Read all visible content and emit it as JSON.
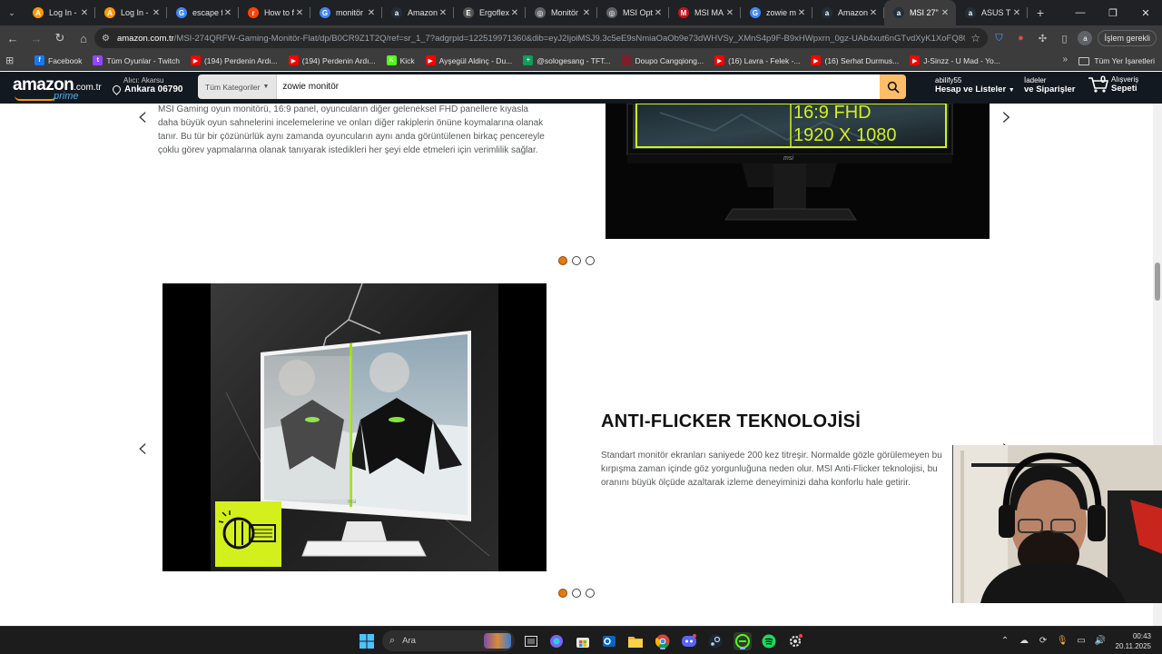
{
  "browser": {
    "tabs": [
      {
        "title": "Log In -",
        "icon": "aws-icon",
        "color": "#ff9900",
        "glyph": "A",
        "active": false
      },
      {
        "title": "Log In - ",
        "icon": "aws-icon",
        "color": "#ff9900",
        "glyph": "A",
        "active": false
      },
      {
        "title": "escape f",
        "icon": "google-icon",
        "color": "#4285f4",
        "glyph": "G",
        "active": false
      },
      {
        "title": "How to f",
        "icon": "reddit-icon",
        "color": "#ff4500",
        "glyph": "r",
        "active": false
      },
      {
        "title": "monitör",
        "icon": "google-icon",
        "color": "#4285f4",
        "glyph": "G",
        "active": false
      },
      {
        "title": "Amazon.",
        "icon": "amazon-icon",
        "color": "#232f3e",
        "glyph": "a",
        "active": false
      },
      {
        "title": "Ergoflex",
        "icon": "ergoflex-icon",
        "color": "#555555",
        "glyph": "E",
        "active": false
      },
      {
        "title": "Monitör",
        "icon": "globe-icon",
        "color": "#5f6368",
        "glyph": "◎",
        "active": false
      },
      {
        "title": "MSI Opt",
        "icon": "globe-icon",
        "color": "#5f6368",
        "glyph": "◎",
        "active": false
      },
      {
        "title": "MSI MA",
        "icon": "msi-icon",
        "color": "#c5161d",
        "glyph": "M",
        "active": false
      },
      {
        "title": "zowie m",
        "icon": "google-icon",
        "color": "#4285f4",
        "glyph": "G",
        "active": false
      },
      {
        "title": "Amazon",
        "icon": "amazon-icon",
        "color": "#232f3e",
        "glyph": "a",
        "active": false
      },
      {
        "title": "MSI 27\"",
        "icon": "amazon-icon",
        "color": "#232f3e",
        "glyph": "a",
        "active": true
      },
      {
        "title": "ASUS TU",
        "icon": "amazon-icon",
        "color": "#232f3e",
        "glyph": "a",
        "active": false
      }
    ],
    "url_domain": "amazon.com.tr",
    "url_path": "/MSI-274QRFW-Gaming-Monitör-Flat/dp/B0CR9Z1T2Q/ref=sr_1_7?adgrpid=122519971360&dib=eyJ2IjoiMSJ9.3c5eE9sNmiaOaOb9e73dWHVSy_XMnS4p9F-B9xHWpxrn_0gz-UAb4xut6nGTvdXyK1XoFQ80GP9-R...",
    "done_label": "İşlem gerekli",
    "profile_initial": "a"
  },
  "bookmarks": [
    {
      "label": "Facebook",
      "icon": "facebook-icon",
      "color": "#1877f2",
      "glyph": "f"
    },
    {
      "label": "Tüm Oyunlar - Twitch",
      "icon": "twitch-icon",
      "color": "#9146ff",
      "glyph": "t"
    },
    {
      "label": "(194) Perdenin Ardı...",
      "icon": "youtube-icon",
      "color": "#ff0000",
      "glyph": "▶"
    },
    {
      "label": "(194) Perdenin Ardı...",
      "icon": "youtube-icon",
      "color": "#ff0000",
      "glyph": "▶"
    },
    {
      "label": "Kick",
      "icon": "kick-icon",
      "color": "#53fc18",
      "glyph": "K"
    },
    {
      "label": "Ayşegül Aldinç - Du...",
      "icon": "youtube-icon",
      "color": "#ff0000",
      "glyph": "▶"
    },
    {
      "label": "@sologesang - TFT...",
      "icon": "sheets-icon",
      "color": "#0f9d58",
      "glyph": "+"
    },
    {
      "label": "Doupo Cangqiong...",
      "icon": "site-icon",
      "color": "#7a1f2b",
      "glyph": ""
    },
    {
      "label": "(16) Lavra - Felek -...",
      "icon": "youtube-icon",
      "color": "#ff0000",
      "glyph": "▶"
    },
    {
      "label": "(16) Serhat Durmus...",
      "icon": "youtube-icon",
      "color": "#ff0000",
      "glyph": "▶"
    },
    {
      "label": "J-Sinzz - U Mad - Yo...",
      "icon": "youtube-icon",
      "color": "#ff0000",
      "glyph": "▶"
    }
  ],
  "bookmarks_all": "Tüm Yer İşaretleri",
  "amazon": {
    "logo_word": "amazon",
    "logo_tld": ".com.tr",
    "logo_prime": "prime",
    "deliver_line1": "Alıcı: Akarsu",
    "deliver_line2": "Ankara 06790",
    "search_category": "Tüm Kategoriler",
    "search_value": "zowie monitör",
    "account_line1": "abilify55",
    "account_line2": "Hesap ve Listeler",
    "orders_line1": "İadeler",
    "orders_line2": "ve Siparişler",
    "cart_count": "0",
    "cart_line1": "Alışveriş",
    "cart_line2": "Sepeti"
  },
  "section1": {
    "text": "MSI Gaming oyun monitörü, 16:9 panel, oyuncuların diğer geleneksel FHD panellere kıyasla daha büyük oyun sahnelerini incelemelerine ve onları diğer rakiplerin önüne koymalarına olanak tanır. Bu tür bir çözünürlük aynı zamanda oyuncuların aynı anda görüntülenen birkaç pencereyle çoklu görev yapmalarına olanak tanıyarak istedikleri her şeyi elde etmeleri için verimlilik sağlar.",
    "banner_line1": "16:9 FHD",
    "banner_line2": "1920 X 1080",
    "banner_brand": "msi",
    "dots_active": 0
  },
  "section2": {
    "title": "ANTI-FLICKER TEKNOLOJİSİ",
    "text": "Standart monitör ekranları saniyede 200 kez titreşir. Normalde gözle görülemeyen bu kırpışma zaman içinde göz yorgunluğuna neden olur. MSI Anti-Flicker teknolojisi, bu oranını büyük ölçüde azaltarak izleme deneyiminizi daha konforlu hale getirir.",
    "dots_active": 0
  },
  "taskbar": {
    "search_label": "Ara",
    "time": "00:43",
    "date": "20.11.2025"
  },
  "colors": {
    "amazon_navy": "#131921",
    "amazon_orange": "#febd69",
    "dot_active": "#e47911",
    "af_badge": "#d4f01c"
  }
}
